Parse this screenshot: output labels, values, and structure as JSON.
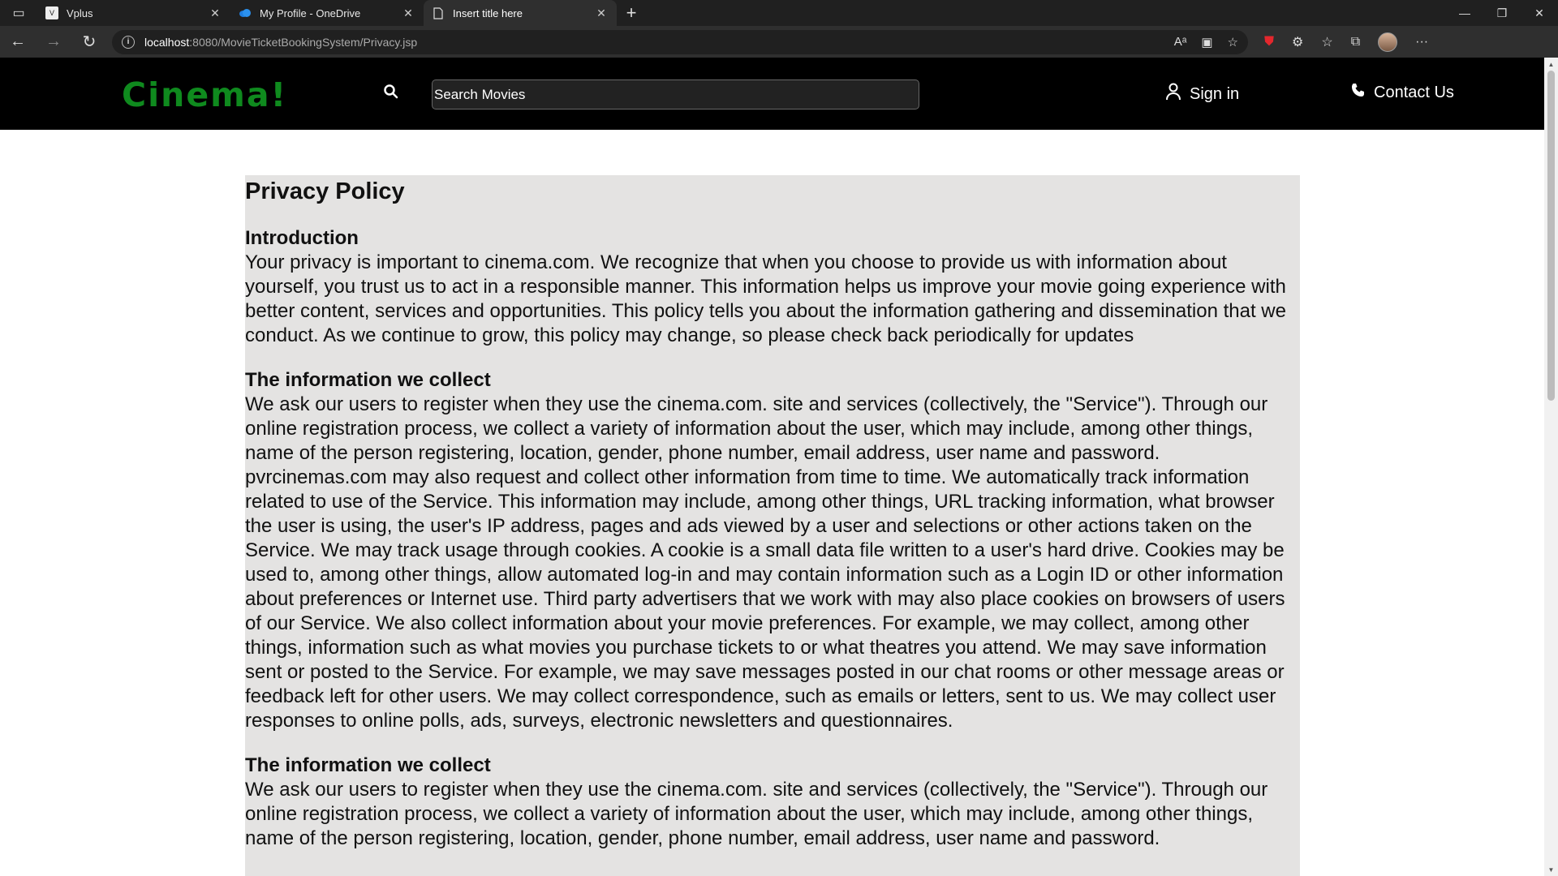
{
  "browser": {
    "tabs": [
      {
        "title": "Vplus",
        "icon": "vplus-favicon"
      },
      {
        "title": "My Profile - OneDrive",
        "icon": "onedrive-favicon"
      },
      {
        "title": "Insert title here",
        "icon": "page-icon"
      }
    ],
    "url_host": "localhost",
    "url_rest": ":8080/MovieTicketBookingSystem/Privacy.jsp"
  },
  "header": {
    "logo": "Cinema!",
    "search_placeholder": "Search Movies",
    "signin_label": "Sign in",
    "contact_label": "Contact Us"
  },
  "content": {
    "title": "Privacy Policy",
    "sections": [
      {
        "heading": "Introduction",
        "body": "Your privacy is important to cinema.com. We recognize that when you choose to provide us with information about yourself, you trust us to act in a responsible manner. This information helps us improve your movie going experience with better content, services and opportunities. This policy tells you about the information gathering and dissemination that we conduct. As we continue to grow, this policy may change, so please check back periodically for updates"
      },
      {
        "heading": "The information we collect",
        "body": "We ask our users to register when they use the cinema.com. site and services (collectively, the \"Service\"). Through our online registration process, we collect a variety of information about the user, which may include, among other things, name of the person registering, location, gender, phone number, email address, user name and password. pvrcinemas.com may also request and collect other information from time to time. We automatically track information related to use of the Service. This information may include, among other things, URL tracking information, what browser the user is using, the user's IP address, pages and ads viewed by a user and selections or other actions taken on the Service. We may track usage through cookies. A cookie is a small data file written to a user's hard drive. Cookies may be used to, among other things, allow automated log-in and may contain information such as a Login ID or other information about preferences or Internet use. Third party advertisers that we work with may also place cookies on browsers of users of our Service. We also collect information about your movie preferences. For example, we may collect, among other things, information such as what movies you purchase tickets to or what theatres you attend. We may save information sent or posted to the Service. For example, we may save messages posted in our chat rooms or other message areas or feedback left for other users. We may collect correspondence, such as emails or letters, sent to us. We may collect user responses to online polls, ads, surveys, electronic newsletters and questionnaires."
      },
      {
        "heading": "The information we collect",
        "body": "We ask our users to register when they use the cinema.com. site and services (collectively, the \"Service\"). Through our online registration process, we collect a variety of information about the user, which may include, among other things, name of the person registering, location, gender, phone number, email address, user name and password."
      }
    ]
  }
}
